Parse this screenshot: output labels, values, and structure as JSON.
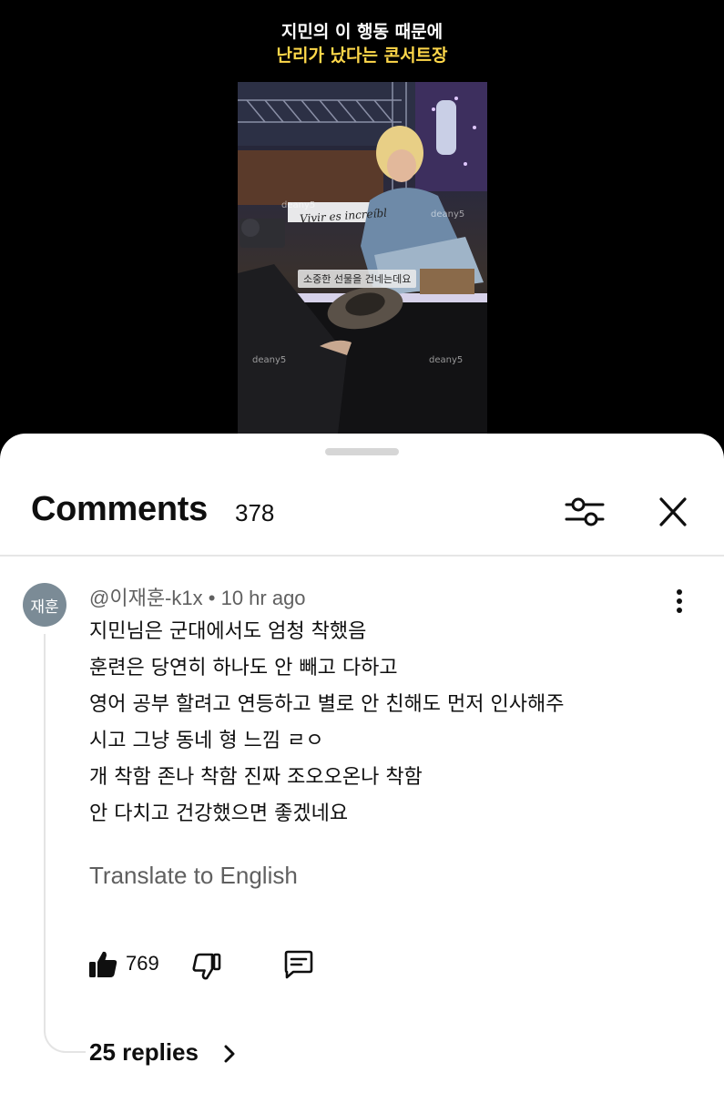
{
  "video": {
    "caption_line1": "지민의 이 행동 때문에",
    "caption_line2": "난리가 났다는 콘서트장",
    "subtitle": "소중한 선물을 건네는데요",
    "sign_text": "Vivir es increíbl",
    "watermark": "deany5"
  },
  "comments": {
    "title": "Comments",
    "count": "378",
    "icons": {
      "filter": "sliders-icon",
      "close": "close-icon"
    }
  },
  "comment": {
    "avatar_text": "재훈",
    "author": "@이재훈-k1x",
    "separator": "•",
    "time": "10 hr ago",
    "lines": [
      "지민님은 군대에서도 엄청 착했음",
      "훈련은 당연히 하나도 안 빼고 다하고",
      "영어 공부 할려고 연등하고 별로 안 친해도 먼저 인사해주",
      "시고 그냥 동네 형 느낌 ㄹㅇ",
      "개 착함 존나 착함 진짜 조오오온나 착함",
      "안 다치고 건강했으면 좋겠네요"
    ],
    "translate": "Translate to English",
    "likes": "769",
    "replies": "25 replies"
  }
}
